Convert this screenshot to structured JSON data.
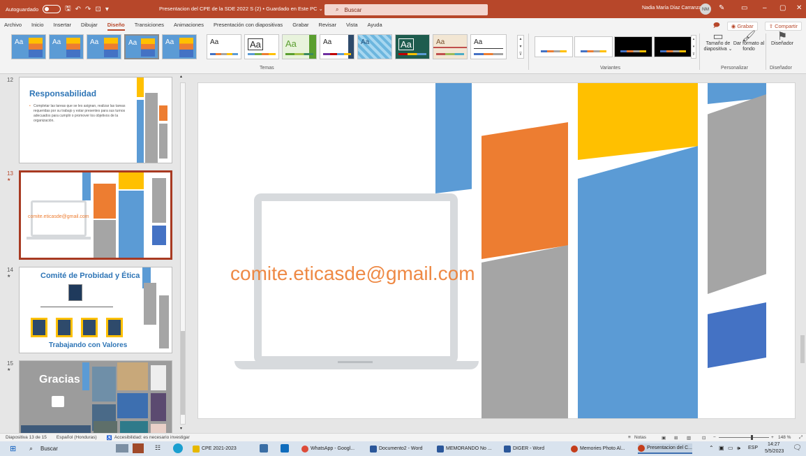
{
  "titlebar": {
    "autosave_label": "Autoguardado",
    "doc_title": "Presentacion del CPE de la SDE 2022 S (2) • Guardado en Este PC ⌄",
    "search_placeholder": "Buscar",
    "user_name": "Nadia María Díaz Carranza",
    "user_initials": "NM"
  },
  "menu": {
    "tabs": [
      "Archivo",
      "Inicio",
      "Insertar",
      "Dibujar",
      "Diseño",
      "Transiciones",
      "Animaciones",
      "Presentación con diapositivas",
      "Grabar",
      "Revisar",
      "Vista",
      "Ayuda"
    ],
    "active_tab": "Diseño",
    "record_label": "Grabar",
    "share_label": "Compartir"
  },
  "ribbon": {
    "theme_sample": "Aa",
    "group_themes": "Temas",
    "group_variants": "Variantes",
    "group_customize": "Personalizar",
    "group_designer": "Diseñador",
    "slide_size_label": "Tamaño de diapositiva ⌄",
    "format_bg_label": "Dar formato al fondo",
    "designer_label": "Diseñador"
  },
  "thumbnails": [
    {
      "number": "12",
      "title": "Responsabilidad",
      "body": "Completar las tareas que se les asignan, realizar las tareas requeridas por su trabajo y estar presentes para sus turnos adecuados para cumplir o promover los objetivos de la organización."
    },
    {
      "number": "13",
      "email": "comite.eticasde@gmail.com"
    },
    {
      "number": "14",
      "title": "Comité de Probidad y Ética",
      "footer": "Trabajando con Valores"
    },
    {
      "number": "15",
      "title": "Gracias"
    }
  ],
  "slide": {
    "email_text": "comite.eticasde@gmail.com"
  },
  "statusbar": {
    "slide_info": "Diapositiva 13 de 15",
    "language": "Español (Honduras)",
    "accessibility": "Accesibilidad: es necesario investigar",
    "notes": "Notas",
    "zoom": "148 %"
  },
  "taskbar": {
    "search_label": "Buscar",
    "apps": [
      "CPE 2021-2023",
      "WhatsApp - Googl...",
      "Documento2 - Word",
      "MEMORANDO No ...",
      "DIGER - Word",
      "Memories Photo Al...",
      "Presentacion del C..."
    ],
    "lang": "ESP",
    "time": "14:27",
    "date": "5/5/2023"
  },
  "colors": {
    "accent": "#b7472a",
    "blue": "#5b9bd5",
    "orange": "#ed7d31",
    "gray": "#a5a5a5",
    "gold": "#ffc000",
    "darkblue": "#4472c4"
  }
}
